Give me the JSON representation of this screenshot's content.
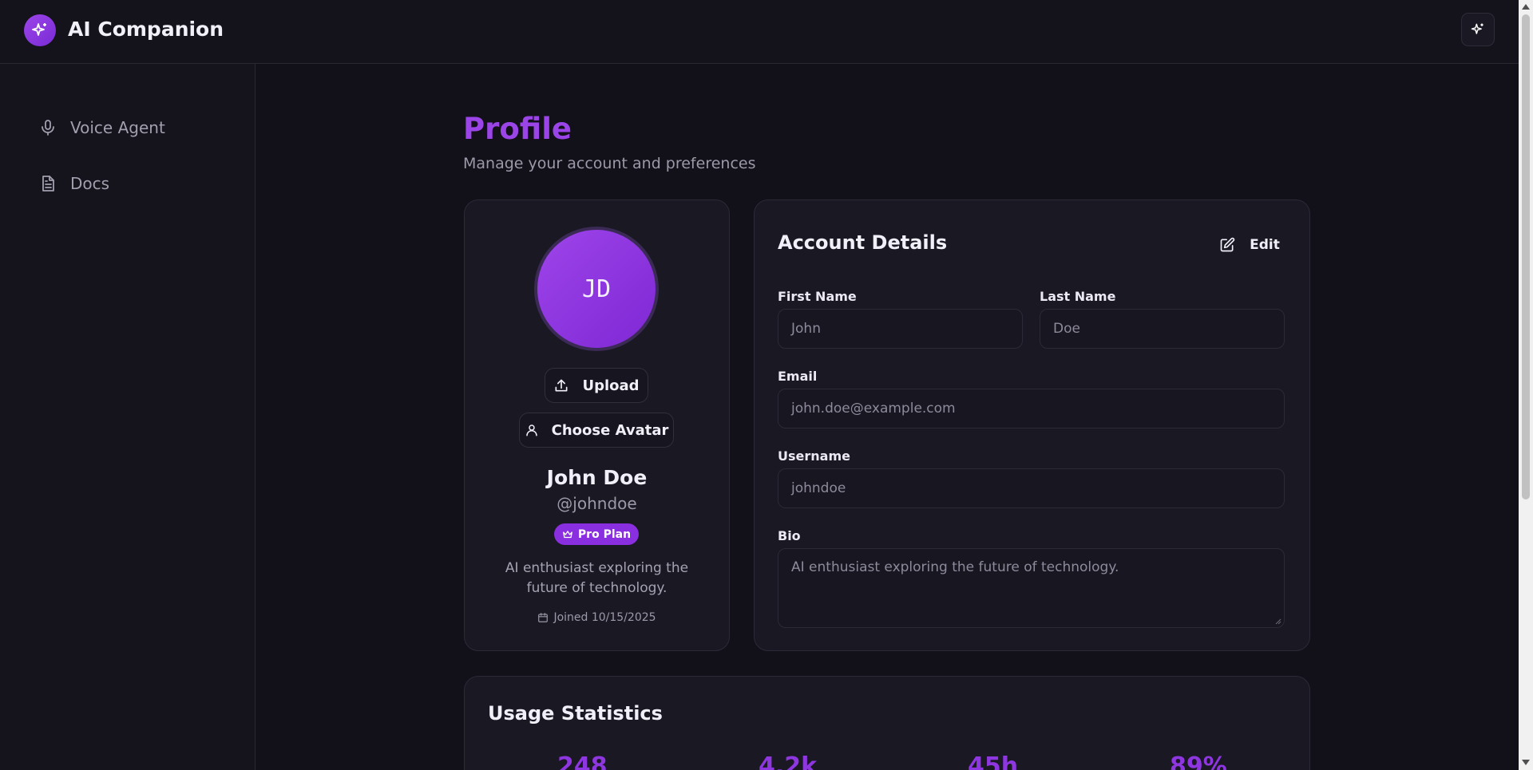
{
  "app": {
    "title": "AI Companion"
  },
  "sidebar": {
    "items": [
      {
        "label": "Voice Agent",
        "icon": "microphone-icon"
      },
      {
        "label": "Docs",
        "icon": "document-icon"
      }
    ]
  },
  "page": {
    "title": "Profile",
    "subtitle": "Manage your account and preferences"
  },
  "profile": {
    "initials": "JD",
    "upload_label": "Upload",
    "choose_avatar_label": "Choose Avatar",
    "name": "John Doe",
    "handle": "@johndoe",
    "plan": "Pro Plan",
    "bio": "AI enthusiast exploring the future of technology.",
    "joined": "Joined 10/15/2025"
  },
  "account": {
    "title": "Account Details",
    "edit_label": "Edit",
    "fields": {
      "first_name": {
        "label": "First Name",
        "value": "John"
      },
      "last_name": {
        "label": "Last Name",
        "value": "Doe"
      },
      "email": {
        "label": "Email",
        "value": "john.doe@example.com"
      },
      "username": {
        "label": "Username",
        "value": "johndoe"
      },
      "bio": {
        "label": "Bio",
        "value": "AI enthusiast exploring the future of technology."
      }
    }
  },
  "usage": {
    "title": "Usage Statistics",
    "stats": [
      "248",
      "4.2k",
      "45h",
      "89%"
    ]
  },
  "colors": {
    "accent": "#9b45e8",
    "background": "#121019",
    "card": "#1a1823"
  }
}
